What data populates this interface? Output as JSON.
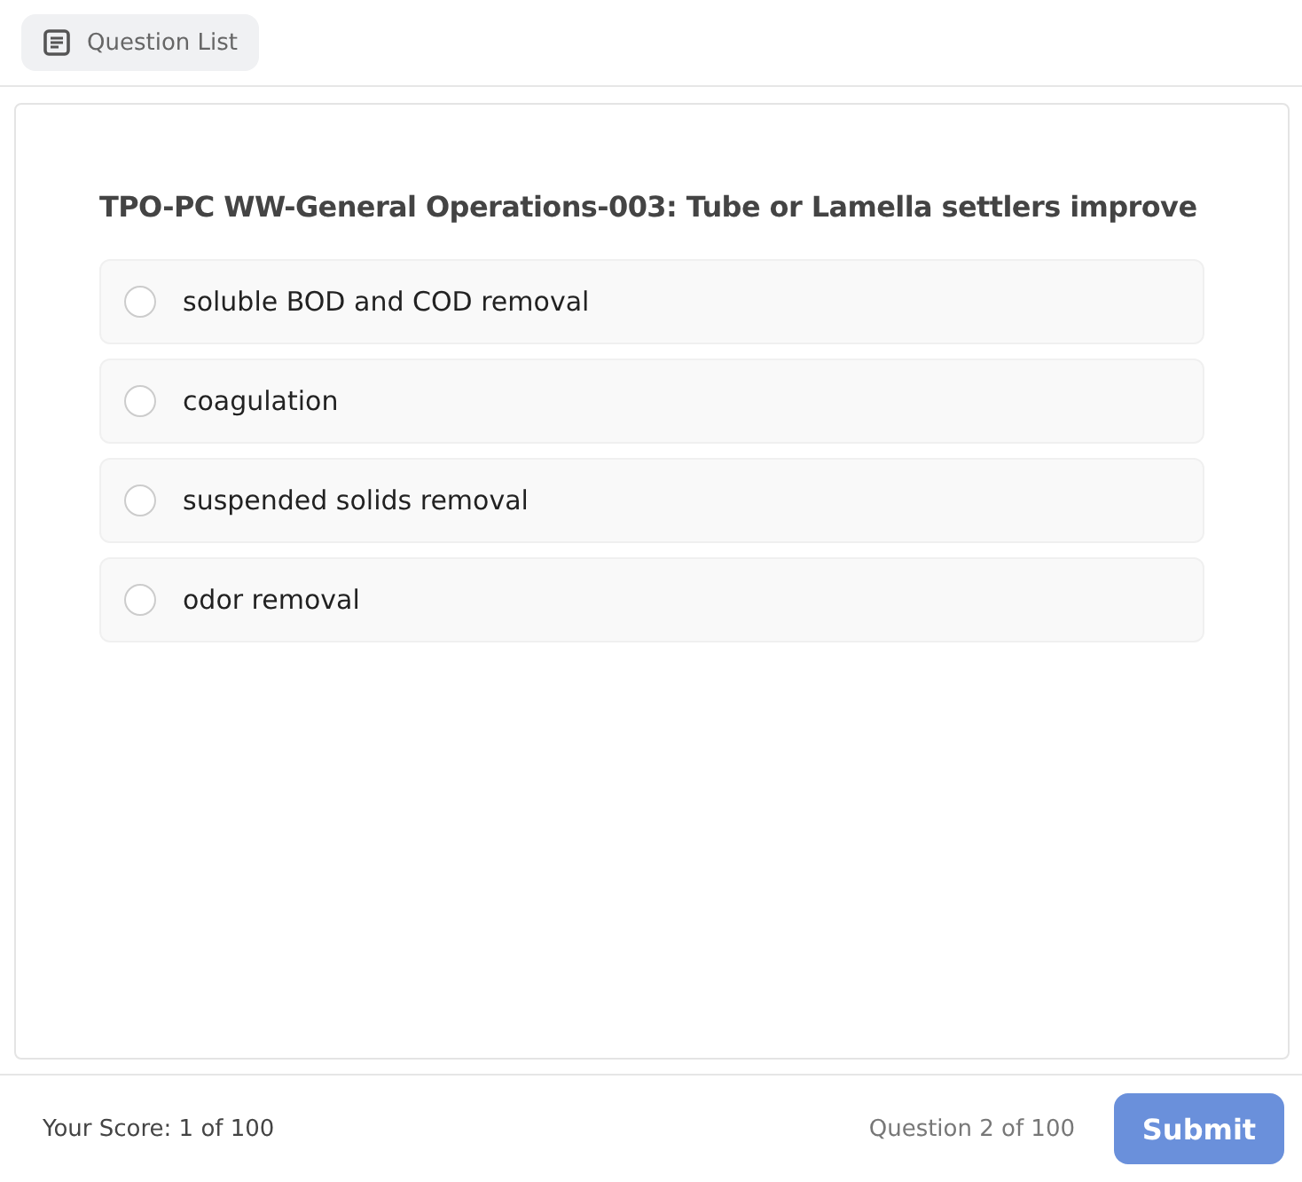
{
  "header": {
    "button": "Question List"
  },
  "question": {
    "text": "TPO-PC WW-General Operations-003: Tube or Lamella settlers improve",
    "options": [
      {
        "label": "soluble BOD and COD removal",
        "selected": false
      },
      {
        "label": "coagulation",
        "selected": false
      },
      {
        "label": "suspended solids removal",
        "selected": false
      },
      {
        "label": "odor removal",
        "selected": false
      }
    ]
  },
  "footer": {
    "score": "Your Score: 1 of 100",
    "progress": "Question 2 of 100",
    "submit": "Submit"
  }
}
